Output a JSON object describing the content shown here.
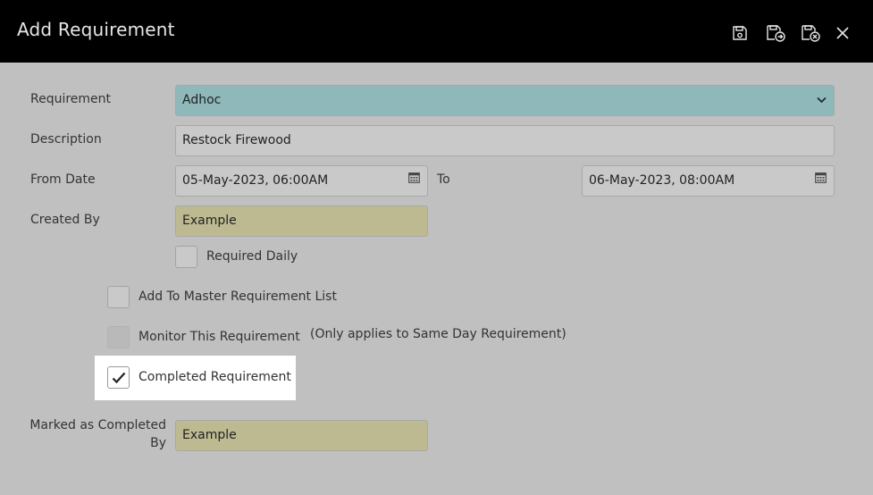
{
  "window": {
    "title": "Add Requirement",
    "icons": [
      "save-icon",
      "save-and-continue-icon",
      "save-and-close-icon",
      "close-icon"
    ]
  },
  "form": {
    "requirement": {
      "label": "Requirement",
      "value": "Adhoc"
    },
    "description": {
      "label": "Description",
      "value": "Restock Firewood"
    },
    "from_date": {
      "label": "From Date",
      "value": "05-May-2023, 06:00AM"
    },
    "to_date": {
      "label": "To",
      "value": "06-May-2023, 08:00AM"
    },
    "created_by": {
      "label": "Created By",
      "value": "Example"
    },
    "required_daily": {
      "label": "Required Daily",
      "checked": false
    },
    "add_to_master": {
      "label": "Add To Master Requirement List",
      "checked": false
    },
    "monitor": {
      "label": "Monitor This Requirement",
      "note": "(Only applies to Same Day Requirement)",
      "checked": false,
      "disabled": true
    },
    "completed": {
      "label": "Completed Requirement",
      "checked": true
    },
    "marked_completed_by": {
      "label_line1": "Marked as Completed",
      "label_line2": "By",
      "value": "Example"
    }
  },
  "colors": {
    "titlebar": "#000000",
    "background": "#c0c0c0",
    "select_fill": "#8fb8bb",
    "readonly_fill": "#bdba91",
    "input_fill": "#c9c9c9"
  }
}
